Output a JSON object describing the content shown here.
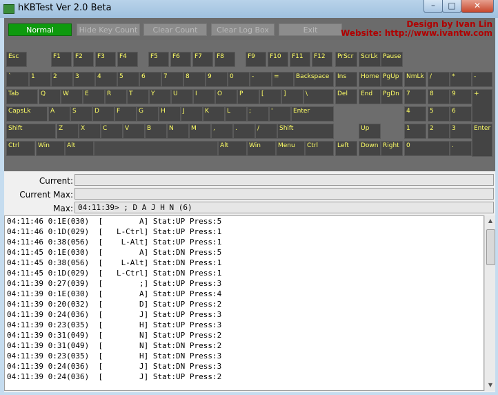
{
  "window": {
    "title": "hKBTest Ver 2.0 Beta",
    "controls": {
      "minimize": "–",
      "maximize": "□",
      "close": "✕"
    }
  },
  "toolbar": {
    "buttons": [
      "Normal",
      "Hide Key Count",
      "Clear Count",
      "Clear Log Box",
      "Exit"
    ],
    "credit_line1": "Design by Ivan Lin",
    "credit_line2": "Website: http://www.ivantw.com"
  },
  "keyboard": {
    "keys": [
      "Esc",
      "F1",
      "F2",
      "F3",
      "F4",
      "F5",
      "F6",
      "F7",
      "F8",
      "F9",
      "F10",
      "F11",
      "F12",
      "PrScr",
      "ScrLk",
      "Pause",
      "`",
      "1",
      "2",
      "3",
      "4",
      "5",
      "6",
      "7",
      "8",
      "9",
      "0",
      "-",
      "=",
      "Backspace",
      "Ins",
      "Home",
      "PgUp",
      "NmLk",
      "/",
      "*",
      "-",
      "Tab",
      "Q",
      "W",
      "E",
      "R",
      "T",
      "Y",
      "U",
      "I",
      "O",
      "P",
      "[",
      "]",
      "\\",
      "Del",
      "End",
      "PgDn",
      "7",
      "8",
      "9",
      "+",
      "CapsLk",
      "A",
      "S",
      "D",
      "F",
      "G",
      "H",
      "J",
      "K",
      "L",
      ";",
      "'",
      "Enter",
      "4",
      "5",
      "6",
      "Shift",
      "Z",
      "X",
      "C",
      "V",
      "B",
      "N",
      "M",
      ",",
      ".",
      "/",
      "Shift",
      "Up",
      "1",
      "2",
      "3",
      "Enter",
      "Ctrl",
      "Win",
      "Alt",
      "",
      "Alt",
      "Win",
      "Menu",
      "Ctrl",
      "Left",
      "Down",
      "Right",
      "0",
      "."
    ]
  },
  "info": {
    "current_label": "Current:",
    "current_value": "",
    "current_max_label": "Current Max:",
    "current_max_value": "",
    "max_label": "Max:",
    "max_value": "04:11:39> ; D A J H N (6)"
  },
  "log": [
    "04:11:46 0:1E(030)  [        A] Stat:UP Press:5",
    "04:11:46 0:1D(029)  [   L-Ctrl] Stat:UP Press:1",
    "04:11:46 0:38(056)  [    L-Alt] Stat:UP Press:1",
    "04:11:45 0:1E(030)  [        A] Stat:DN Press:5",
    "04:11:45 0:38(056)  [    L-Alt] Stat:DN Press:1",
    "04:11:45 0:1D(029)  [   L-Ctrl] Stat:DN Press:1",
    "04:11:39 0:27(039)  [        ;] Stat:UP Press:3",
    "04:11:39 0:1E(030)  [        A] Stat:UP Press:4",
    "04:11:39 0:20(032)  [        D] Stat:UP Press:2",
    "04:11:39 0:24(036)  [        J] Stat:UP Press:3",
    "04:11:39 0:23(035)  [        H] Stat:UP Press:3",
    "04:11:39 0:31(049)  [        N] Stat:UP Press:2",
    "04:11:39 0:31(049)  [        N] Stat:DN Press:2",
    "04:11:39 0:23(035)  [        H] Stat:DN Press:3",
    "04:11:39 0:24(036)  [        J] Stat:DN Press:3",
    "04:11:39 0:24(036)  [        J] Stat:UP Press:2"
  ]
}
